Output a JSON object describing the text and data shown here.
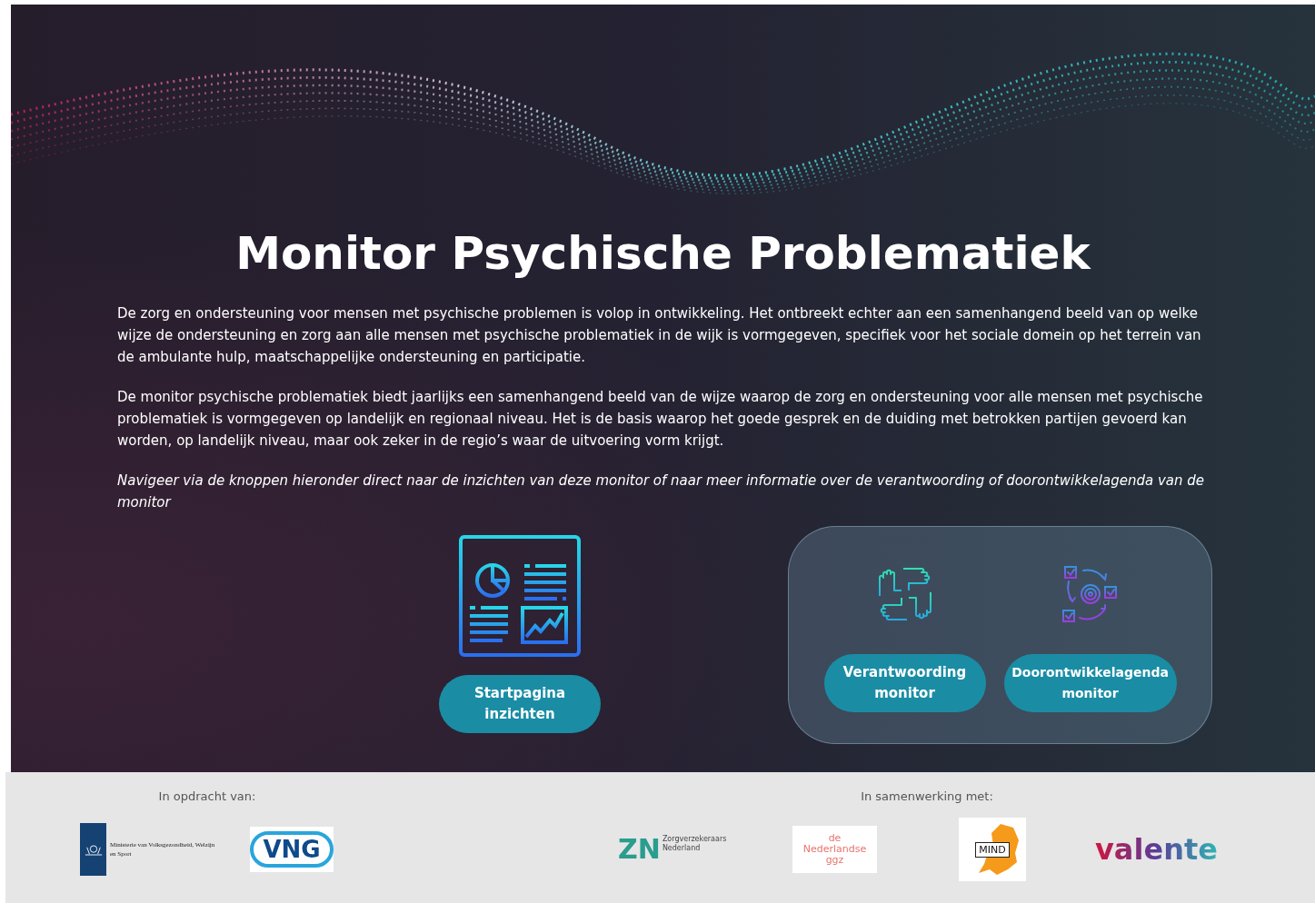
{
  "hero": {
    "title": "Monitor Psychische Problematiek",
    "paragraphs": [
      {
        "text": "De zorg en ondersteuning voor mensen met psychische problemen is volop in ontwikkeling. Het ontbreekt echter aan een samenhangend beeld van op welke wijze de ondersteuning en zorg aan alle mensen met psychische problematiek in de wijk is vormgegeven, specifiek voor het sociale domein op het terrein van de ambulante hulp, maatschappelijke ondersteuning en participatie.",
        "italic": false
      },
      {
        "text": "De monitor psychische problematiek biedt jaarlijks een samenhangend beeld van de wijze waarop de zorg en ondersteuning voor alle mensen met psychische problematiek is vormgegeven op landelijk en regionaal niveau.  Het is de basis waarop het goede gesprek en de duiding met betrokken partijen gevoerd kan worden, op landelijk niveau, maar ook zeker in de regio’s waar de uitvoering vorm krijgt.",
        "italic": false
      },
      {
        "text": "Navigeer via de knoppen hieronder direct naar de inzichten van deze monitor of naar meer informatie over de verantwoording of doorontwikkelagenda van de monitor",
        "italic": true
      }
    ]
  },
  "start": {
    "kind": "dashboard",
    "button": "Startpagina inzichten"
  },
  "panel": {
    "items": [
      {
        "kind": "hands",
        "button": "Verantwoording monitor"
      },
      {
        "kind": "cycle",
        "button": "Doorontwikkelagenda monitor"
      }
    ]
  },
  "footer": {
    "groups": [
      {
        "label": "In opdracht van:",
        "logos": [
          {
            "kind": "ministry",
            "lines": [
              "Ministerie van Volksgezondheid,",
              "Welzijn en Sport"
            ]
          },
          {
            "kind": "vng",
            "lines": [
              "VNG"
            ]
          }
        ]
      },
      {
        "label": "In samenwerking met:",
        "logos": [
          {
            "kind": "zn",
            "lines": [
              "ZN",
              "Zorgverzekeraars Nederland"
            ]
          },
          {
            "kind": "ggz",
            "lines": [
              "de",
              "Nederlandse",
              "ggz"
            ]
          },
          {
            "kind": "mind",
            "lines": [
              "MIND"
            ]
          },
          {
            "kind": "valente",
            "lines": [
              "valente"
            ]
          }
        ]
      }
    ]
  }
}
